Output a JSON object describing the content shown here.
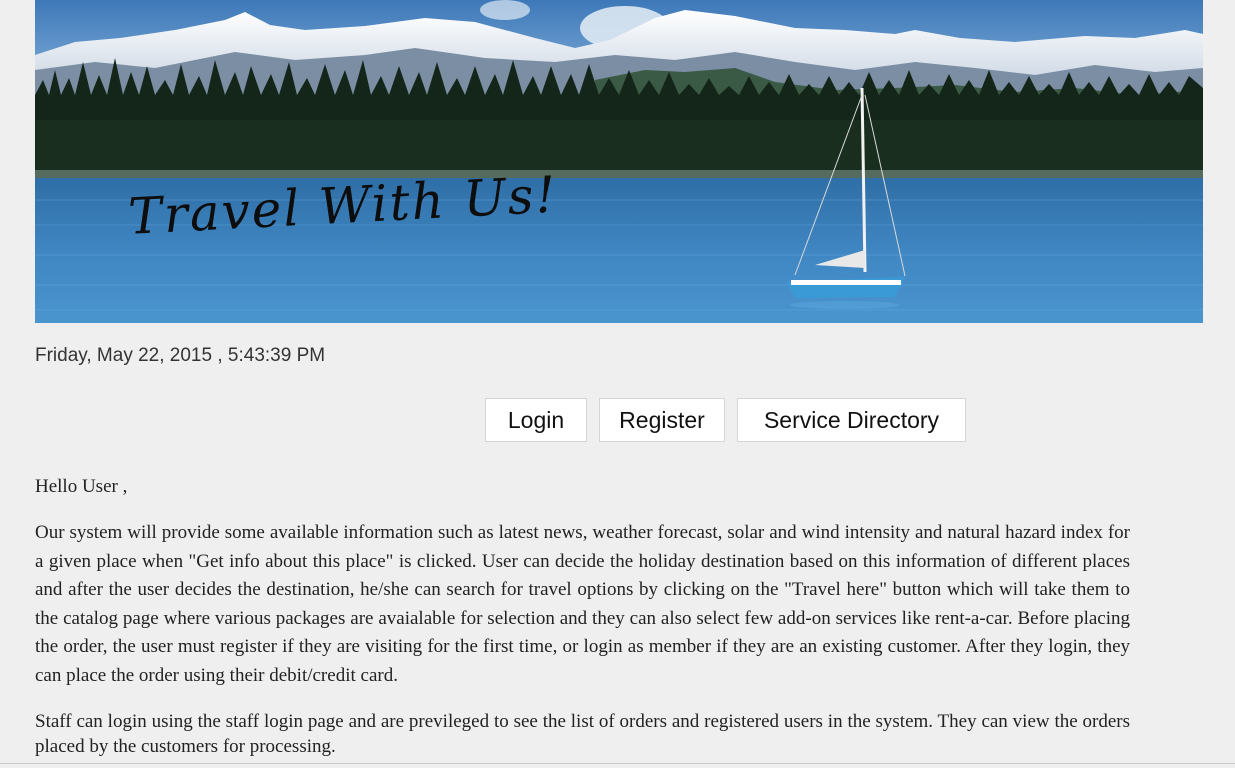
{
  "banner": {
    "title": "Travel With Us!",
    "colors": {
      "sky_top": "#3d78b8",
      "sky_bottom": "#9cc3e6",
      "water_top": "#2f6ea6",
      "water_bottom": "#4b95cf",
      "boat_hull": "#3a9ad6"
    }
  },
  "datetime": "Friday, May 22, 2015 , 5:43:39 PM",
  "nav": {
    "login": "Login",
    "register": "Register",
    "services": "Service Directory"
  },
  "content": {
    "greeting": "Hello User ,",
    "paragraph1": "Our system will provide some available information such as latest news, weather forecast, solar and wind intensity and natural hazard index for a given place when \"Get info about this place\" is clicked. User can decide the holiday destination based on this information of different places and after the user decides the destination, he/she can search for travel options by clicking on the \"Travel here\" button which will take them to the catalog page where various packages are avaialable for selection and they can also select few add-on services like rent-a-car. Before placing the order, the user must register if they are visiting for the first time, or login as member if they are an existing customer. After they login, they can place the order using their debit/credit card.",
    "paragraph2": "Staff can login using the staff login page and are previleged to see the list of orders and registered users in the system. They can view the orders placed by the customers for processing."
  }
}
